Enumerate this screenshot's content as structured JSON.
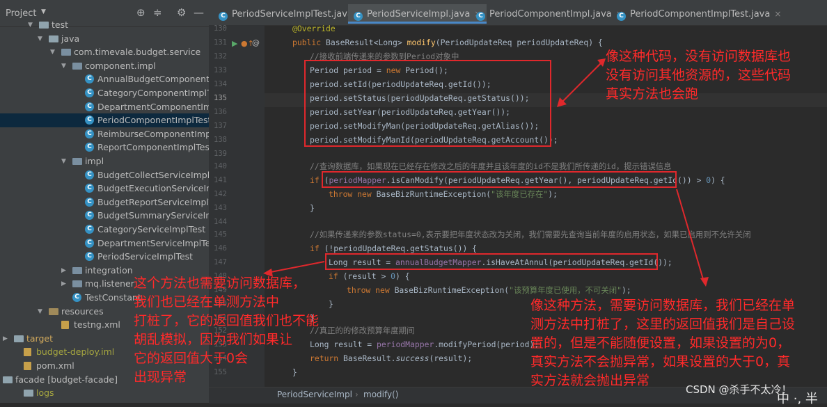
{
  "project": {
    "title": "Project",
    "toolbar_icons": [
      "globe-icon",
      "collapse-icon",
      "gear-icon",
      "minimize-icon"
    ],
    "tree": [
      {
        "label": "test",
        "kind": "folder",
        "arrow": "down"
      },
      {
        "label": "java",
        "kind": "folder",
        "arrow": "down"
      },
      {
        "label": "com.timevale.budget.service",
        "kind": "package",
        "arrow": "down"
      },
      {
        "label": "component.impl",
        "kind": "package",
        "arrow": "down"
      },
      {
        "label": "AnnualBudgetComponentImplTest",
        "kind": "class"
      },
      {
        "label": "CategoryComponentImplTest",
        "kind": "class"
      },
      {
        "label": "DepartmentComponentImplTest",
        "kind": "class"
      },
      {
        "label": "PeriodComponentImplTest",
        "kind": "class",
        "selected": true
      },
      {
        "label": "ReimburseComponentImplTest",
        "kind": "class"
      },
      {
        "label": "ReportComponentImplTest",
        "kind": "class"
      },
      {
        "label": "impl",
        "kind": "package",
        "arrow": "down"
      },
      {
        "label": "BudgetCollectServiceImplTest",
        "kind": "class"
      },
      {
        "label": "BudgetExecutionServiceImplTest",
        "kind": "class"
      },
      {
        "label": "BudgetReportServiceImplTest",
        "kind": "class"
      },
      {
        "label": "BudgetSummaryServiceImplTest",
        "kind": "class"
      },
      {
        "label": "CategoryServiceImplTest",
        "kind": "class"
      },
      {
        "label": "DepartmentServiceImplTest",
        "kind": "class"
      },
      {
        "label": "PeriodServiceImplTest",
        "kind": "class"
      },
      {
        "label": "integration",
        "kind": "package",
        "arrow": "right"
      },
      {
        "label": "mq.listener",
        "kind": "package",
        "arrow": "right"
      },
      {
        "label": "TestConstant",
        "kind": "class"
      },
      {
        "label": "resources",
        "kind": "resources",
        "arrow": "down"
      },
      {
        "label": "testng.xml",
        "kind": "xml"
      },
      {
        "label": "target",
        "kind": "target",
        "arrow": "right"
      },
      {
        "label": "budget-deploy.iml",
        "kind": "iml"
      },
      {
        "label": "pom.xml",
        "kind": "pom"
      },
      {
        "label": "facade [budget-facade]",
        "kind": "module",
        "arrow": "right"
      },
      {
        "label": "logs",
        "kind": "logs"
      }
    ]
  },
  "editor": {
    "tabs": [
      {
        "label": "PeriodServiceImplTest.java",
        "active": false,
        "close": "×"
      },
      {
        "label": "PeriodServiceImpl.java",
        "active": true,
        "close": "×"
      },
      {
        "label": "PeriodComponentImpl.java",
        "active": false,
        "close": "×"
      },
      {
        "label": "PeriodComponentImplTest.java",
        "active": false,
        "close": "×"
      }
    ],
    "line_numbers": [
      "130",
      "131",
      "132",
      "133",
      "134",
      "135",
      "136",
      "137",
      "138",
      "139",
      "140",
      "141",
      "142",
      "143",
      "144",
      "145",
      "146",
      "147",
      "148",
      "149",
      "150",
      "151",
      "152",
      "153",
      "154",
      "155"
    ],
    "current_line": "135",
    "breadcrumb": [
      "PeriodServiceImpl",
      "modify()"
    ],
    "breadcrumb_sep": "›"
  },
  "annotations": {
    "note_top_right": "像这种代码，没有访问数据库也\n没有访问其他资源的，这些代码\n真实方法也会跑",
    "note_left": "这个方法也需要访问数据库，\n我们也已经在单测方法中\n打桩了，它的返回值我们也不能\n胡乱模拟，因为我们如果让\n它的返回值大于0会\n出现异常",
    "note_bottom_right": "像这种方法，需要访问数据库，我们已经在单\n测方法中打桩了，这里的返回值我们是自己设\n置的，但是不能随便设置，如果设置的为0，\n真实方法不会抛异常，如果设置的大于0，真\n实方法就会抛出异常",
    "watermark": "CSDN @杀手不太冷！",
    "corner_text": "中 ·, 半"
  },
  "colors": {
    "annotation_red": "#e0282c",
    "selection": "#0d293e",
    "tab_underline": "#4a88c7"
  }
}
